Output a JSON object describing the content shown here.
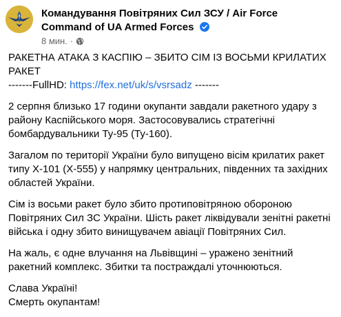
{
  "author": {
    "name_line1": "Командування Повітряних Сил ЗСУ / Air Force",
    "name_line2": "Command of UA Armed Forces",
    "timestamp": "8 мин.",
    "separator": "·",
    "verified_icon": "verified-badge",
    "audience_icon": "globe-icon"
  },
  "post": {
    "headline_line1": "РАКЕТНА АТАКА З КАСПІЮ – ЗБИТО СІМ ІЗ ВОСЬМИ КРИЛАТИХ",
    "headline_line2": "РАКЕТ",
    "fullhd_prefix": "-------FullHD: ",
    "fullhd_link": "https://fex.net/uk/s/vsrsadz",
    "fullhd_suffix": " -------",
    "p1_line1": "2 серпня близько 17 години окупанти завдали ракетного удару з",
    "p1_line2": "району Каспійського моря. Застосовувались стратегічні",
    "p1_line3": "бомбардувальники Ту-95 (Ту-160).",
    "p2_line1": "Загалом по території України було випущено вісім крилатих ракет",
    "p2_line2": "типу Х-101 (Х-555) у напрямку центральних, південних та західних",
    "p2_line3": "областей України.",
    "p3_line1": "Сім із восьми ракет було збито протиповітряною обороною",
    "p3_line2": "Повітряних Сил ЗС України. Шість ракет ліквідували зенітні ракетні",
    "p3_line3": "війська і одну збито винищувачем авіації Повітряних Сил.",
    "p4_line1": "На жаль, є одне влучання на Львівщині – уражено зенітний",
    "p4_line2": "ракетний комплекс. Збитки та постраждалі уточнюються.",
    "p5_line1": "Слава Україні!",
    "p5_line2": "Смерть окупантам!"
  },
  "colors": {
    "link": "#216fdb",
    "verified": "#1877f2",
    "secondary_text": "#65676b",
    "avatar_bg": "#d8b43a"
  }
}
